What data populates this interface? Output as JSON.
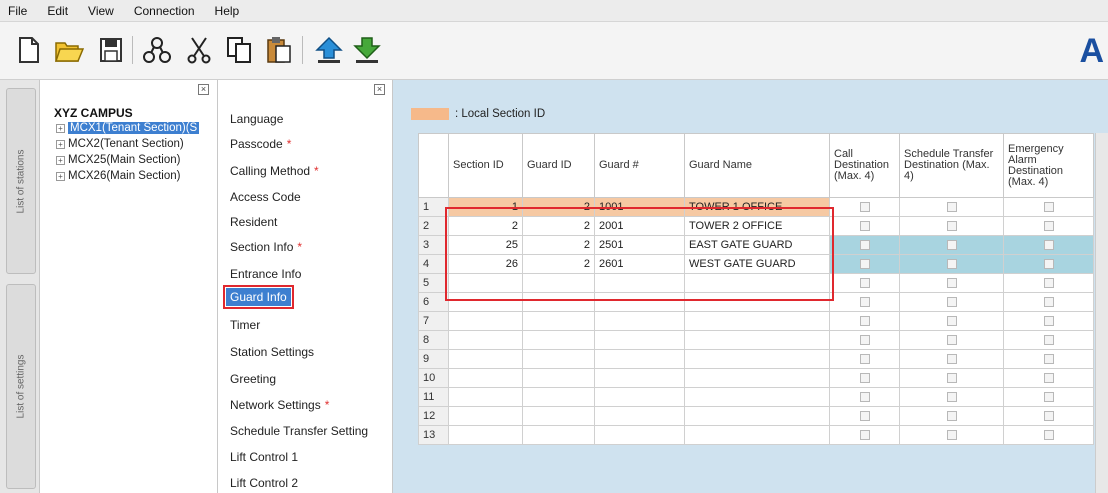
{
  "menu": [
    "File",
    "Edit",
    "View",
    "Connection",
    "Help"
  ],
  "toolbar": {
    "icons": [
      "new-file-icon",
      "open-folder-icon",
      "save-icon",
      "network-icon",
      "cut-icon",
      "copy-icon",
      "paste-icon",
      "upload-icon",
      "download-icon"
    ],
    "brand": "A"
  },
  "left_tabs": {
    "stations": "List of stations",
    "settings": "List of settings"
  },
  "tree": {
    "root": "XYZ CAMPUS",
    "items": [
      {
        "label": "MCX1(Tenant Section)(S",
        "selected": true
      },
      {
        "label": "MCX2(Tenant Section)",
        "selected": false
      },
      {
        "label": "MCX25(Main Section)",
        "selected": false
      },
      {
        "label": "MCX26(Main Section)",
        "selected": false
      }
    ]
  },
  "settings": [
    {
      "label": "Language",
      "required": ""
    },
    {
      "label": "Passcode",
      "required": "*"
    },
    {
      "label": "Calling Method",
      "required": "*"
    },
    {
      "label": "Access Code",
      "required": ""
    },
    {
      "label": "Resident",
      "required": ""
    },
    {
      "label": "Section Info",
      "required": "*"
    },
    {
      "label": "Entrance Info",
      "required": ""
    },
    {
      "label": "Guard Info",
      "required": ""
    },
    {
      "label": "Timer",
      "required": ""
    },
    {
      "label": "Station Settings",
      "required": ""
    },
    {
      "label": "Greeting",
      "required": ""
    },
    {
      "label": "Network Settings",
      "required": "*"
    },
    {
      "label": "Schedule Transfer Setting",
      "required": ""
    },
    {
      "label": "Lift Control 1",
      "required": ""
    },
    {
      "label": "Lift Control 2",
      "required": ""
    }
  ],
  "legend": ": Local Section ID",
  "grid": {
    "headers": [
      "Section ID",
      "Guard ID",
      "Guard #",
      "Guard Name",
      "Call Destination (Max. 4)",
      "Schedule Transfer Destination (Max. 4)",
      "Emergency Alarm Destination (Max. 4)"
    ],
    "rows": [
      {
        "n": "1",
        "section_id": "1",
        "guard_id": "2",
        "guard_no": "1001",
        "guard_name": "TOWER 1 OFFICE"
      },
      {
        "n": "2",
        "section_id": "2",
        "guard_id": "2",
        "guard_no": "2001",
        "guard_name": "TOWER 2 OFFICE"
      },
      {
        "n": "3",
        "section_id": "25",
        "guard_id": "2",
        "guard_no": "2501",
        "guard_name": "EAST GATE GUARD"
      },
      {
        "n": "4",
        "section_id": "26",
        "guard_id": "2",
        "guard_no": "2601",
        "guard_name": "WEST GATE GUARD"
      },
      {
        "n": "5",
        "section_id": "",
        "guard_id": "",
        "guard_no": "",
        "guard_name": ""
      },
      {
        "n": "6",
        "section_id": "",
        "guard_id": "",
        "guard_no": "",
        "guard_name": ""
      },
      {
        "n": "7",
        "section_id": "",
        "guard_id": "",
        "guard_no": "",
        "guard_name": ""
      },
      {
        "n": "8",
        "section_id": "",
        "guard_id": "",
        "guard_no": "",
        "guard_name": ""
      },
      {
        "n": "9",
        "section_id": "",
        "guard_id": "",
        "guard_no": "",
        "guard_name": ""
      },
      {
        "n": "10",
        "section_id": "",
        "guard_id": "",
        "guard_no": "",
        "guard_name": ""
      },
      {
        "n": "11",
        "section_id": "",
        "guard_id": "",
        "guard_no": "",
        "guard_name": ""
      },
      {
        "n": "12",
        "section_id": "",
        "guard_id": "",
        "guard_no": "",
        "guard_name": ""
      },
      {
        "n": "13",
        "section_id": "",
        "guard_id": "",
        "guard_no": "",
        "guard_name": ""
      }
    ]
  },
  "colors": {
    "local_section": "#f6b98a",
    "highlight_blue": "#a8d4e0",
    "selection": "#3d7fd0",
    "annotation_red": "#e0282e"
  }
}
